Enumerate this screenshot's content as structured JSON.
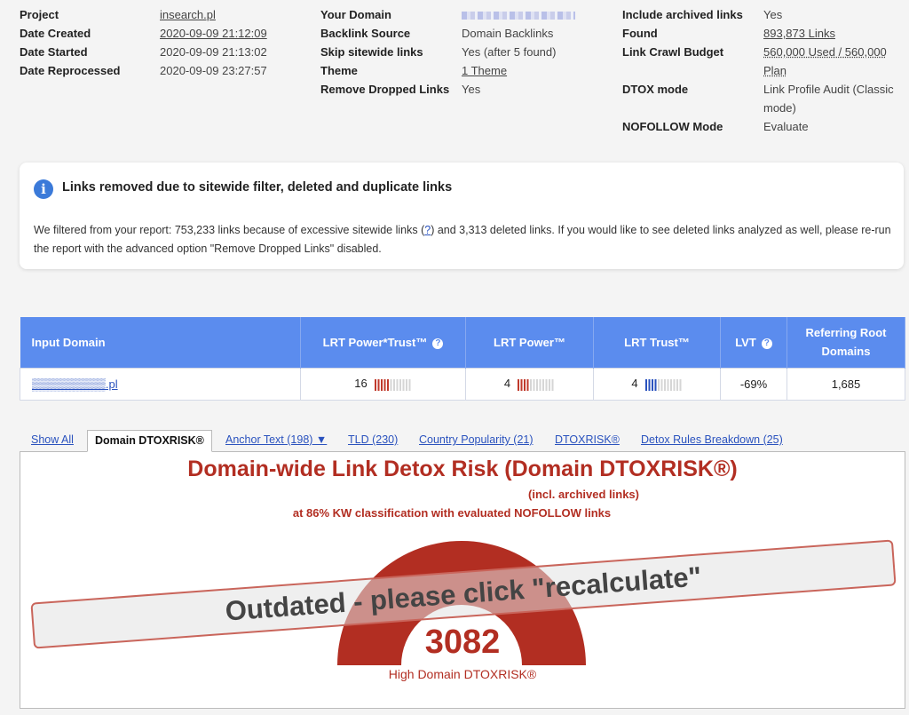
{
  "meta": {
    "col1": [
      {
        "key": "Project",
        "value": "insearch.pl",
        "link": true
      },
      {
        "key": "Date Created",
        "value": "2020-09-09 21:12:09",
        "link": true
      },
      {
        "key": "Date Started",
        "value": "2020-09-09 21:13:02",
        "link": false
      },
      {
        "key": "Date Reprocessed",
        "value": "2020-09-09 23:27:57",
        "link": false
      }
    ],
    "col2": [
      {
        "key": "Your Domain",
        "value": "",
        "blurred": true
      },
      {
        "key": "Backlink Source",
        "value": "Domain Backlinks"
      },
      {
        "key": "Skip sitewide links",
        "value": "Yes (after 5 found)"
      },
      {
        "key": "Theme",
        "value": "1 Theme",
        "link": true
      },
      {
        "key": "Remove Dropped Links",
        "value": "Yes"
      }
    ],
    "col3": [
      {
        "key": "Include archived links",
        "value": "Yes"
      },
      {
        "key": "Found",
        "value": "893,873 Links",
        "link": true
      },
      {
        "key": "Link Crawl Budget",
        "value": "560,000 Used / 560,000 Plan"
      },
      {
        "key": "DTOX mode",
        "value": "Link Profile Audit (Classic mode)"
      },
      {
        "key": "NOFOLLOW Mode",
        "value": "Evaluate"
      }
    ]
  },
  "info": {
    "title": "Links removed due to sitewide filter, deleted and duplicate links",
    "body_part1": "We filtered from your report: 753,233 links because of excessive sitewide links (",
    "help_link": "?",
    "body_part2": ") and 3,313 deleted links. If you would like to see deleted links analyzed as well, please re-run the report with the advanced option \"Remove Dropped Links\" disabled."
  },
  "table": {
    "headers": [
      "Input Domain",
      "LRT Power*Trust™",
      "LRT Power™",
      "LRT Trust™",
      "LVT",
      "Referring Root Domains"
    ],
    "row": {
      "domain": "▒▒▒▒▒▒▒▒▒.pl",
      "power_trust": "16",
      "power": "4",
      "trust": "4",
      "lvt": "-69%",
      "ref_domains": "1,685"
    },
    "bar_levels": {
      "power_trust": 5,
      "power": 4,
      "trust": 4
    },
    "bar_colors": {
      "power_trust": "#c0392b",
      "power": "#c0392b",
      "trust": "#2a52be"
    }
  },
  "tabs": [
    {
      "label": "Show All",
      "active": false
    },
    {
      "label": "Domain DTOXRISK®",
      "active": true
    },
    {
      "label": "Anchor Text (198) ▼",
      "active": false
    },
    {
      "label": "TLD (230)",
      "active": false
    },
    {
      "label": "Country Popularity (21)",
      "active": false
    },
    {
      "label": "DTOXRISK®",
      "active": false
    },
    {
      "label": "Detox Rules Breakdown (25)",
      "active": false
    }
  ],
  "chart": {
    "title": "Domain-wide Link Detox Risk (Domain DTOXRISK®)",
    "subtitle1": "(incl. archived links)",
    "subtitle2": "at 86% KW classification with evaluated NOFOLLOW links",
    "value": "3082",
    "label": "High Domain DTOXRISK®",
    "overlay": "Outdated - please click \"recalculate\"",
    "gauge_color": "#b22e22"
  }
}
